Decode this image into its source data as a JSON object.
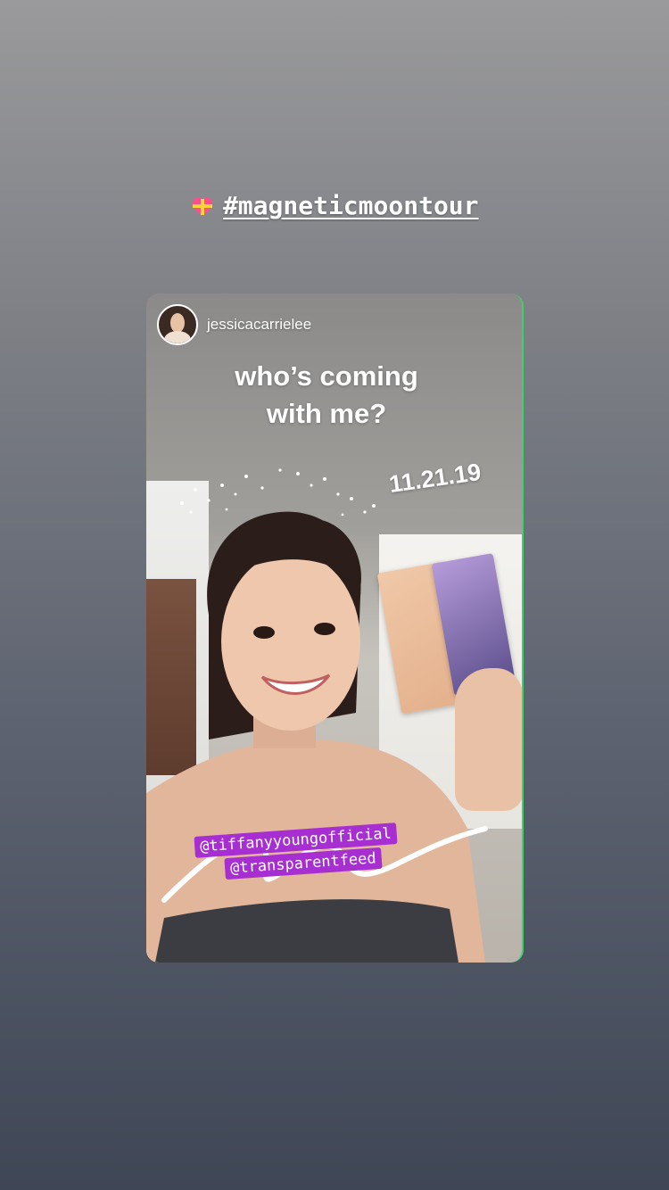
{
  "story": {
    "hashtag": "#magneticmoontour",
    "hashtag_icon": "heart-with-ribbon-icon"
  },
  "shared_post": {
    "username": "jessicacarrielee",
    "caption_line1": "who’s coming",
    "caption_line2": "with me?",
    "date_sticker": "11.21.19",
    "mentions": [
      "@tiffanyyoungofficial",
      "@transparentfeed"
    ]
  },
  "colors": {
    "mention_bg": "#a72fd1",
    "text": "#ffffff"
  }
}
